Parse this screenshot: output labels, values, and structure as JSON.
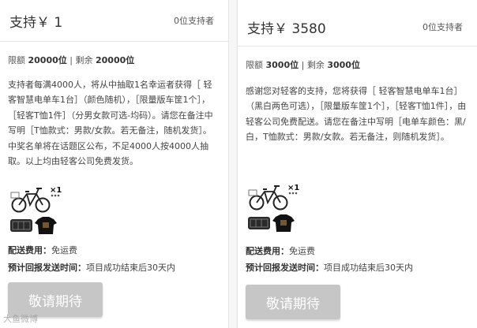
{
  "tiers": [
    {
      "price": "支持￥ 1",
      "backers": "0位支持者",
      "limit_label": "限额",
      "limit_value": "20000位",
      "separator": "|",
      "remaining_label": "剩余",
      "remaining_value": "20000位",
      "description": "支持者每满4000人，将从中抽取1名幸运者获得［ 轻客智慧电单车1台］（颜色随机），［限量版车筐1个］，［轻客T恤1件］（分男女款可选-均码）。请您在备注中写明［T恤款式：男款/女款。若无备注，随机发货］。中奖名单将在话题区公布，不足4000人按4000人抽取。以上均由轻客公司免费发货。",
      "reward_qty": "×1",
      "shipping_label": "配送费用：",
      "shipping_value": "免运费",
      "delivery_label": "预计回报发送时间：",
      "delivery_value": "项目成功结束后30天内",
      "button": "敬请期待"
    },
    {
      "price": "支持￥ 3580",
      "backers": "0位支持者",
      "limit_label": "限额",
      "limit_value": "3000位",
      "separator": "|",
      "remaining_label": "剩余",
      "remaining_value": "3000位",
      "description": "感谢您对轻客的支持，您将获得［ 轻客智慧电单车1台］（黑白两色可选），［限量版车筐1个］，［轻客T恤1件］，由轻客公司免费配送。请您在备注中写明［电单车颜色：黑/白，T恤款式：男款/女款。若无备注，则随机发货］。",
      "reward_qty": "×1",
      "shipping_label": "配送费用：",
      "shipping_value": "免运费",
      "delivery_label": "预计回报发送时间：",
      "delivery_value": "项目成功结束后30天内",
      "button": "敬请期待"
    }
  ],
  "watermark": "大鱼微博",
  "colors": {
    "button_bg": "#c6c6c6",
    "button_text": "#ffffff",
    "border": "#e5e5e5"
  }
}
